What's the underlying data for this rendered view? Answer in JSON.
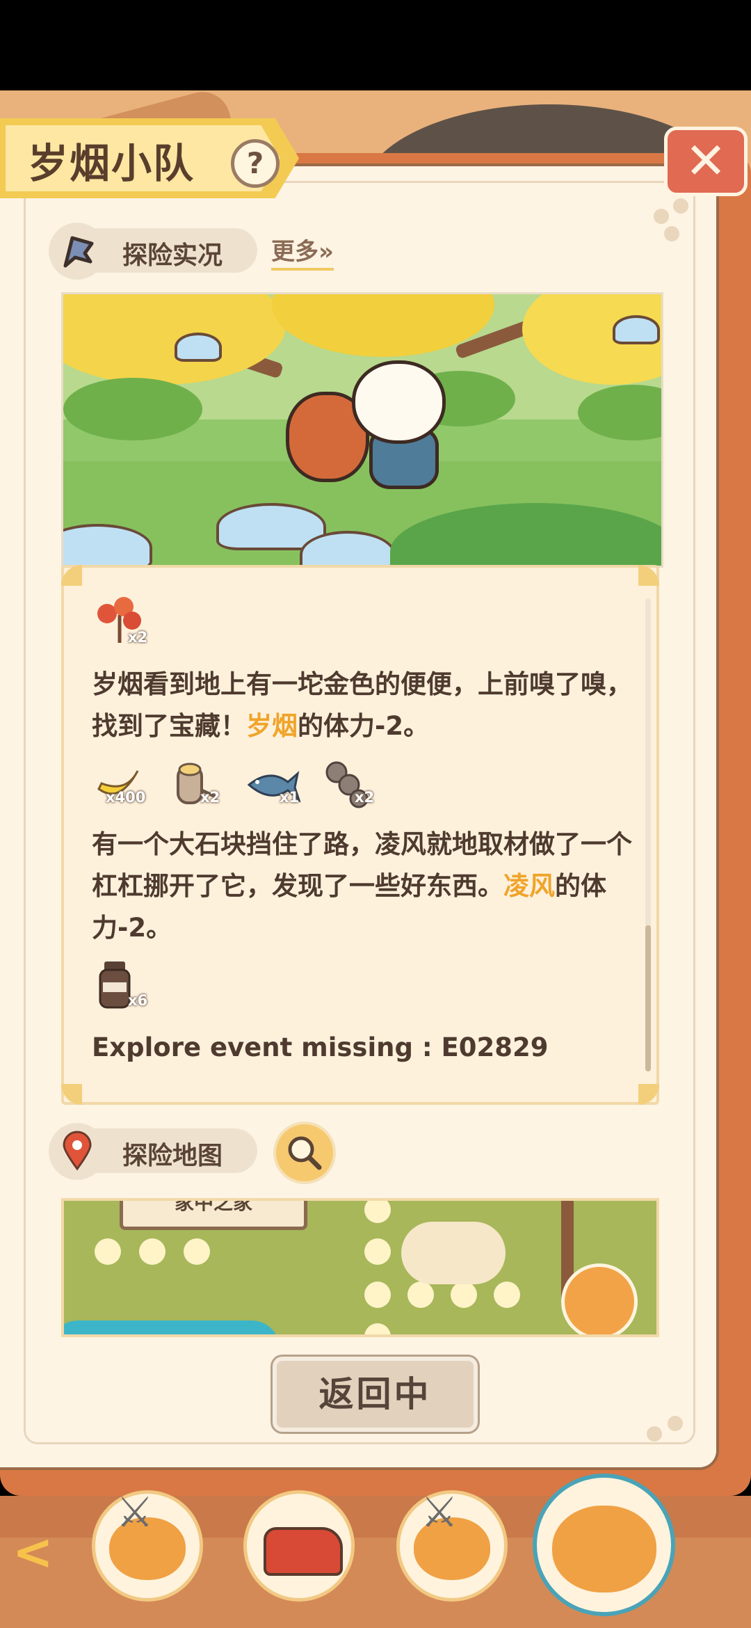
{
  "title": "岁烟小队",
  "help_icon": "?",
  "close_icon": "✕",
  "report_section": {
    "label": "探险实况",
    "more_link": "更多»"
  },
  "log": {
    "entries": [
      {
        "items": [
          {
            "icon": "red-leaf-icon",
            "qty": "x2"
          }
        ],
        "text_parts": [
          "岁烟看到地上有一坨金色的便便，上前嗅了嗅，找到了宝藏！",
          "岁烟",
          "的体力-2。"
        ]
      },
      {
        "items": [
          {
            "icon": "banana-icon",
            "qty": "x400"
          },
          {
            "icon": "wood-log-icon",
            "qty": "x2"
          },
          {
            "icon": "fish-icon",
            "qty": "x1"
          },
          {
            "icon": "stone-icon",
            "qty": "x2"
          }
        ],
        "text_parts": [
          "有一个大石块挡住了路，凌风就地取材做了一个杠杠挪开了它，发现了一些好东西。",
          "凌风",
          "的体力-2。"
        ]
      },
      {
        "items": [
          {
            "icon": "jar-icon",
            "qty": "x6"
          }
        ],
        "text_parts": [
          "Explore event missing : E02829"
        ]
      }
    ]
  },
  "map_section": {
    "label": "探险地图"
  },
  "map_sign": "家中之家",
  "return_button": "返回中",
  "nav": {
    "back_icon": "<"
  },
  "colors": {
    "highlight": "#f0a42a",
    "panel": "#fdf1dc",
    "accent": "#d97845"
  }
}
